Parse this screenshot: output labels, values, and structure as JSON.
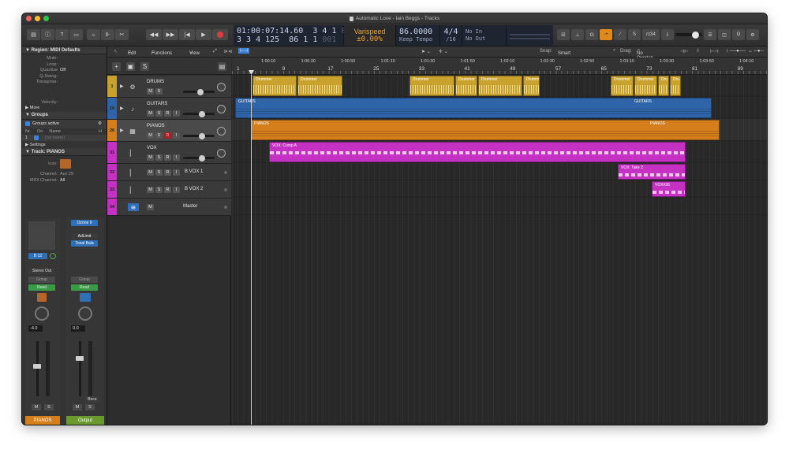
{
  "window": {
    "title": "Automatic Love - Iain Beggs - Tracks"
  },
  "lcd": {
    "time_main": "01:00:07:14.60",
    "time_sub": "3 4 1",
    "time_sub_dim": "001",
    "bars_main": "3 3 4 125",
    "bars_sub": "86 1 1",
    "bars_sub_dim": "001",
    "varispeed_label": "Varispeed",
    "varispeed_value": "±0.00%",
    "tempo": "86.0000",
    "tempo_mode": "Keep Tempo",
    "sig_top": "4/4",
    "sig_bottom": "/16",
    "in": "No In",
    "out": "No Out"
  },
  "controlbar": {
    "right_label": "rz34"
  },
  "inspector": {
    "region_header": "Region: MIDI Defaults",
    "rows": [
      {
        "label": "Mute:",
        "value": ""
      },
      {
        "label": "Loop:",
        "value": ""
      },
      {
        "label": "Quantize",
        "value": "Off"
      },
      {
        "label": "Q-Swing:",
        "value": ""
      },
      {
        "label": "Transpose:",
        "value": ""
      },
      {
        "label": "Velocity:",
        "value": ""
      }
    ],
    "more": "More",
    "groups_header": "Groups",
    "groups_active": "Groups active",
    "groups_cols": [
      "Nr.",
      "On",
      "Name",
      "H"
    ],
    "groups_row": [
      "1",
      "",
      "(no name)",
      ""
    ],
    "settings": "Settings",
    "track_header": "Track: PIANOS",
    "icon_label": "Icon:",
    "channel_label": "Channel:",
    "channel_value": "Aux 25",
    "midi_channel_label": "MIDI Channel:",
    "midi_channel_value": "All"
  },
  "strip_left": {
    "plugin1": "",
    "io": "B 12",
    "output": "Stereo Out",
    "group": "Group",
    "automation": "Read",
    "value": "-4.0",
    "mute": "M",
    "solo": "S",
    "name": "PIANOS",
    "color": "#d47e1c"
  },
  "strip_right": {
    "plugin1": "Ozone 9",
    "plugin2": "AdLimit",
    "plugin3": "Tonal Bala",
    "group": "Group",
    "automation": "Read",
    "value": "0.0",
    "bounce": "Bnce",
    "mute": "M",
    "solo": "S",
    "name": "Output",
    "color": "#6a9a2e"
  },
  "toolbar": {
    "edit": "Edit",
    "functions": "Functions",
    "view": "View",
    "snap_label": "Snap:",
    "snap_value": "Smart",
    "drag_label": "Drag:",
    "drag_value": "No Overlap"
  },
  "ruler": {
    "times": [
      "1:00:10",
      "1:00:30",
      "1:00:50",
      "1:01:10",
      "1:01:30",
      "1:01:50",
      "1:02:10",
      "1:02:30",
      "1:02:50",
      "1:03:10",
      "1:03:30",
      "1:03:50",
      "1:04:10"
    ],
    "bars": [
      "1",
      "9",
      "17",
      "25",
      "33",
      "41",
      "49",
      "57",
      "65",
      "73",
      "81",
      "89"
    ]
  },
  "tracks": [
    {
      "num": "1",
      "name": "DRUMS",
      "color": "#c9a22e",
      "buttons": [
        "M",
        "S"
      ]
    },
    {
      "num": "19",
      "name": "GUITARS",
      "color": "#2f65a8",
      "buttons": [
        "M",
        "S",
        "R",
        "I"
      ]
    },
    {
      "num": "26",
      "name": "PIANOS",
      "color": "#d47e1c",
      "buttons": [
        "M",
        "S",
        "R",
        "I"
      ]
    },
    {
      "num": "31",
      "name": "VOX",
      "color": "#c531c3",
      "buttons": [
        "M",
        "S",
        "R",
        "I"
      ]
    },
    {
      "num": "32",
      "name": "B VOX 1",
      "color": "#c531c3",
      "buttons": [
        "M",
        "S",
        "R",
        "I"
      ]
    },
    {
      "num": "33",
      "name": "B VOX 2",
      "color": "#c531c3",
      "buttons": [
        "M",
        "S",
        "R",
        "I"
      ]
    },
    {
      "num": "34",
      "name": "Master",
      "color": "#c531c3",
      "buttons": [
        "M"
      ]
    }
  ],
  "regions": {
    "drummer": "Drummer",
    "drummer_short": "Drumm",
    "dru": "Dru",
    "guitars": "GUITARS",
    "pianos": "PIANOS",
    "vox_comp": "VOX: Comp A",
    "vox_take": "VOX: Take 2",
    "vox_36": "VOX#36"
  }
}
